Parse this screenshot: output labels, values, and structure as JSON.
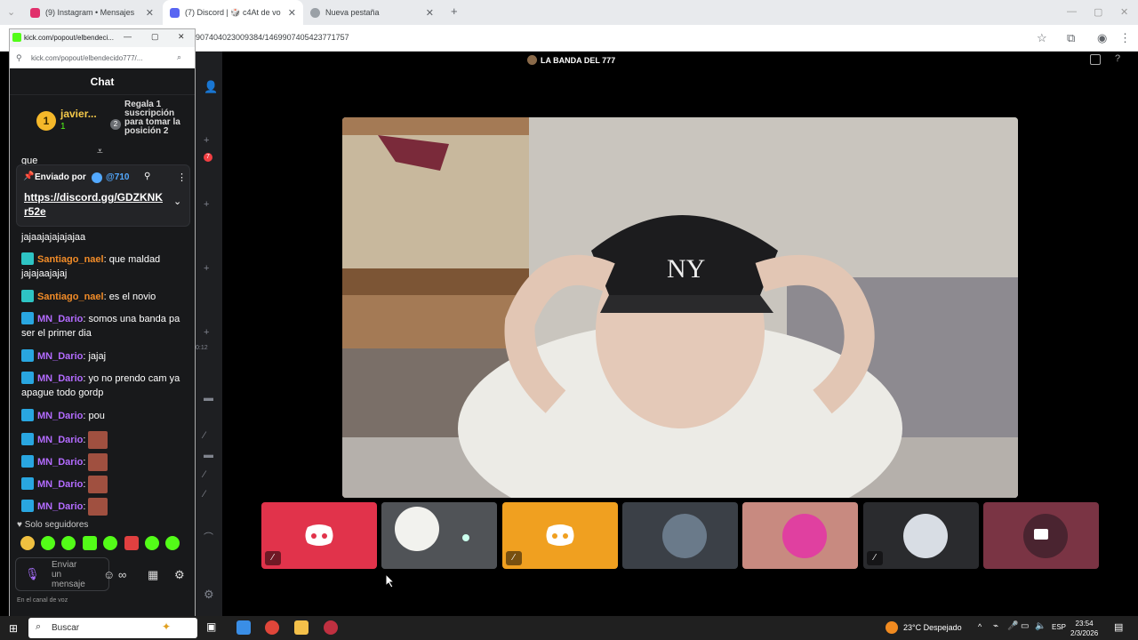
{
  "browser": {
    "tabs": [
      {
        "label": "(9) Instagram • Mensajes"
      },
      {
        "label": "(7) Discord | 🎲 c4At de vo"
      },
      {
        "label": "Nueva pestaña"
      }
    ],
    "url": "907404023009384/1469907405423771757"
  },
  "popout": {
    "title": "kick.com/popout/elbendeci...",
    "url": "kick.com/popout/elbendecido777/..."
  },
  "chat": {
    "title": "Chat",
    "leader": {
      "rank": "1",
      "name": "javier...",
      "count": "1",
      "rank2": "2",
      "gift_text": "Regala 1 suscripción para tomar la posición 2"
    },
    "partial_top": "gue",
    "pinned": {
      "sent_by": "Enviado por",
      "user": "@710",
      "link": "https://discord.gg/GDZKNKr52e"
    },
    "messages": [
      {
        "user": "",
        "text": "jajaajajajajajaa"
      },
      {
        "user": "Santiago_nael",
        "text": ": que maldad jajajaajajaj"
      },
      {
        "user": "Santiago_nael",
        "text": ": es el novio"
      },
      {
        "user": "MN_Dario",
        "text": ": somos una banda pa ser el primer dia"
      },
      {
        "user": "MN_Dario",
        "text": ": jajaj"
      },
      {
        "user": "MN_Dario",
        "text": ": yo no prendo cam ya apague todo gordp"
      },
      {
        "user": "MN_Dario",
        "text": ": pou"
      },
      {
        "user": "MN_Dario",
        "text": ":"
      },
      {
        "user": "MN_Dario",
        "text": ":"
      },
      {
        "user": "MN_Dario",
        "text": ":"
      },
      {
        "user": "MN_Dario",
        "text": ":"
      }
    ],
    "followers_only": "Solo seguidores",
    "input_placeholder": "Enviar un mensaje",
    "colors": {
      "santiago": "#f28c28",
      "dario": "#b36bff",
      "accent": "#53fc18"
    }
  },
  "discord": {
    "channel_title": "LA BANDA DEL 777",
    "voice_status": "En el canal de voz",
    "strip_time": "0:12"
  },
  "taskbar": {
    "search": "Buscar",
    "weather": "23°C  Despejado",
    "lang": "ESP",
    "time": "23:54",
    "date": "2/3/2026"
  }
}
